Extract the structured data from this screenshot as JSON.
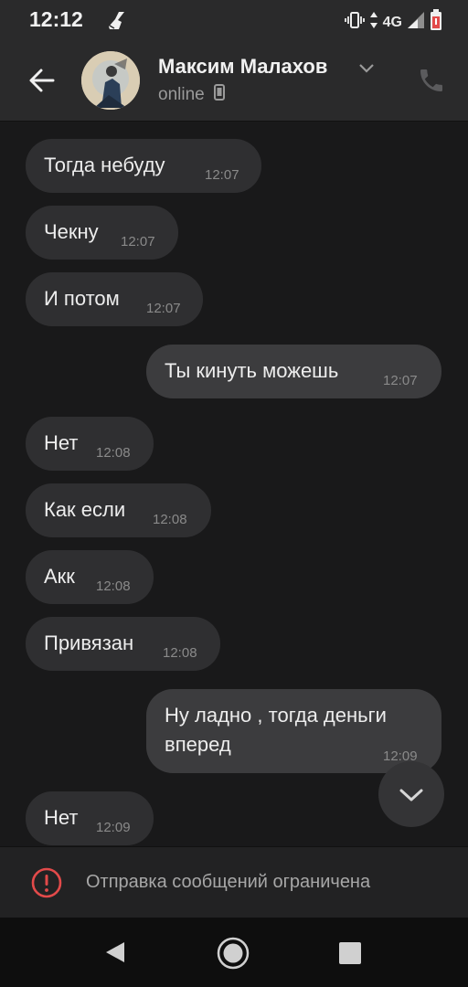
{
  "status_bar": {
    "time": "12:12",
    "network": "4G",
    "icons": [
      "broom-icon",
      "vibrate-icon",
      "data-arrows-icon",
      "signal-icon",
      "battery-icon"
    ]
  },
  "header": {
    "contact_name": "Максим Малахов",
    "status": "online",
    "icons": [
      "back-arrow-icon",
      "chevron-down-icon",
      "mobile-device-icon",
      "phone-icon"
    ]
  },
  "messages": [
    {
      "text": "Тогда  небуду",
      "time": "12:07",
      "direction": "in"
    },
    {
      "text": "Чекну",
      "time": "12:07",
      "direction": "in"
    },
    {
      "text": "И потом",
      "time": "12:07",
      "direction": "in"
    },
    {
      "text": "Ты кинуть можешь",
      "time": "12:07",
      "direction": "out"
    },
    {
      "text": "Нет",
      "time": "12:08",
      "direction": "in"
    },
    {
      "text": "Как если",
      "time": "12:08",
      "direction": "in"
    },
    {
      "text": "Акк",
      "time": "12:08",
      "direction": "in"
    },
    {
      "text": "Привязан",
      "time": "12:08",
      "direction": "in"
    },
    {
      "text": "Ну ладно , тогда деньги",
      "text_line2": "вперед",
      "time": "12:09",
      "direction": "out"
    },
    {
      "text": "Нет",
      "time": "12:09",
      "direction": "in"
    }
  ],
  "footer": {
    "restricted_text": "Отправка сообщений ограничена",
    "icon": "warning-icon"
  },
  "colors": {
    "background": "#19191a",
    "header": "#2a2a2b",
    "bubble_in": "#2f2f31",
    "bubble_out": "#3c3c3e",
    "warning": "#e24a4a"
  }
}
